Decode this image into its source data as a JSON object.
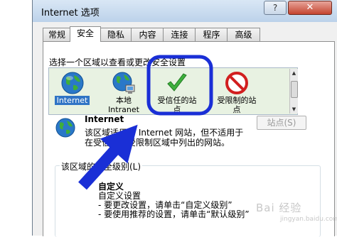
{
  "window": {
    "title": "Internet 选项",
    "help_label": "?",
    "close_label": "✕"
  },
  "tabs": [
    {
      "label": "常规"
    },
    {
      "label": "安全",
      "active": true
    },
    {
      "label": "隐私"
    },
    {
      "label": "内容"
    },
    {
      "label": "连接"
    },
    {
      "label": "程序"
    },
    {
      "label": "高级"
    }
  ],
  "security": {
    "zone_prompt": "选择一个区域以查看或更改安全设置",
    "zones": [
      {
        "label_1": "Internet",
        "label_2": "",
        "icon": "globe-icon",
        "selected": true
      },
      {
        "label_1": "本地",
        "label_2": "Intranet",
        "icon": "intranet-icon"
      },
      {
        "label_1": "受信任的站",
        "label_2": "点",
        "icon": "checkmark-icon"
      },
      {
        "label_1": "受限制的站",
        "label_2": "点",
        "icon": "restricted-icon"
      }
    ],
    "selected_zone_title": "Internet",
    "zone_description_1": "该区域适用于 Internet 网站，但不适用于",
    "zone_description_2": "在受信任和受限制区域中列出的网站。",
    "sites_button_label": "站点(S)",
    "group_caption": "该区域的安全级别(L)",
    "level_title": "自定义",
    "level_desc_1": "自定义设置",
    "level_desc_2": "- 要更改设置，请单击“自定义级别”",
    "level_desc_3": "- 要使用推荐的设置，请单击“默认级别”"
  },
  "watermark": {
    "brand": "Bai 经验",
    "url": "jingyan.baidu.com"
  },
  "colors": {
    "annotation": "#1a2fd6",
    "zone_list_bg": "#e8f2e2",
    "selection": "#3074c5"
  }
}
